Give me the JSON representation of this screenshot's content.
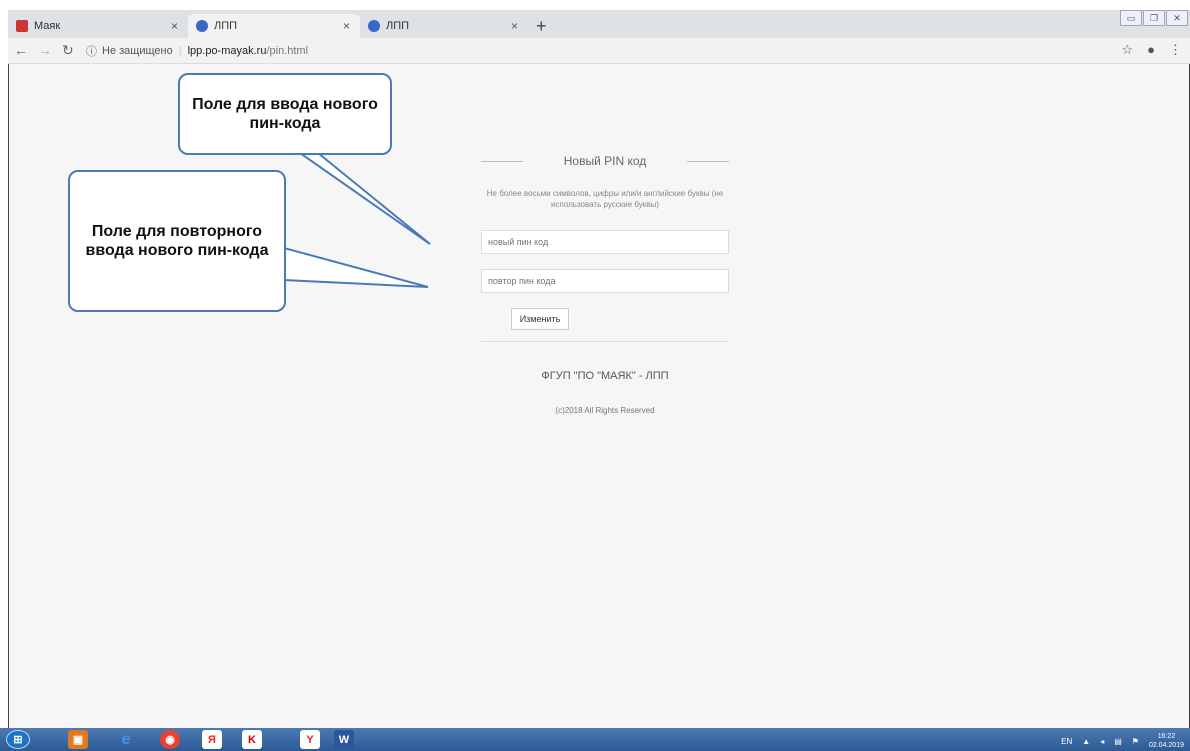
{
  "browser": {
    "tabs": [
      {
        "label": "Маяк",
        "active": false
      },
      {
        "label": "ЛПП",
        "active": true
      },
      {
        "label": "ЛПП",
        "active": false
      }
    ],
    "tab_close_glyph": "×",
    "new_tab_glyph": "+",
    "security_label": "Не защищено",
    "url_host": "lpp.po-mayak.ru",
    "url_path": "/pin.html",
    "icons": [
      "back-icon",
      "forward-icon",
      "reload-icon",
      "info-icon",
      "star-icon",
      "account-icon",
      "menu-icon"
    ]
  },
  "form": {
    "title": "Новый PIN код",
    "hint": "Не более восьми символов, цифры или/и английские буквы (не использовать русские буквы)",
    "new_pin_placeholder": "новый пин код",
    "repeat_pin_placeholder": "повтор пин кода",
    "submit_label": "Изменить",
    "org": "ФГУП \"ПО \"МАЯК\" - ЛПП",
    "copyright": "(c)2018 All Rights Reserved"
  },
  "callouts": {
    "new_pin": "Поле для ввода нового пин-кода",
    "repeat_pin": "Поле для повторного ввода нового пин-кода"
  },
  "taskbar": {
    "lang": "EN",
    "time": "16:22",
    "date": "02.04.2019",
    "accent": "#2c5a93"
  }
}
